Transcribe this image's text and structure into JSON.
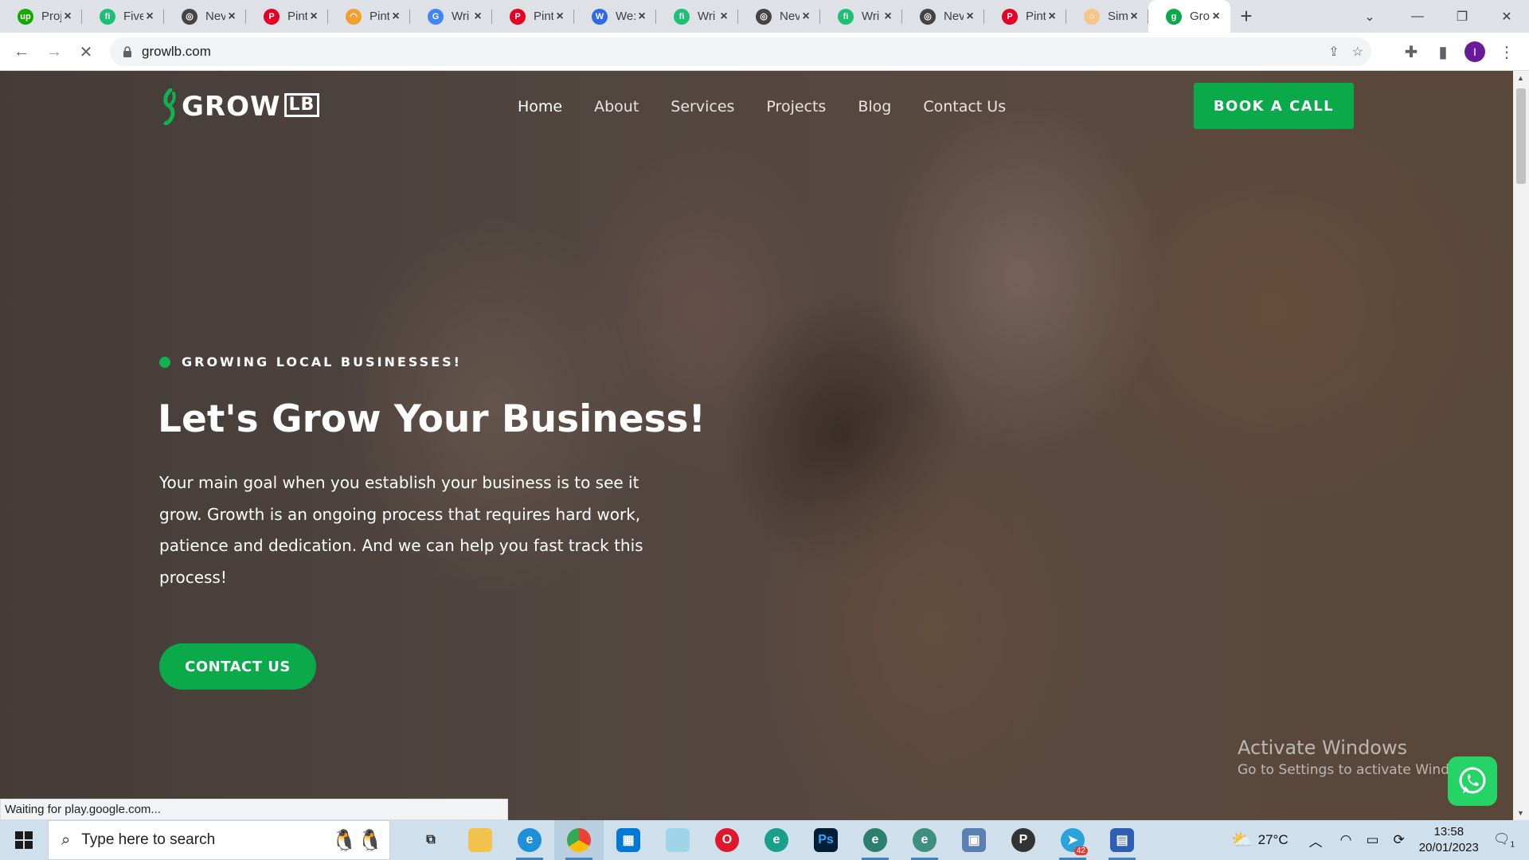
{
  "browser": {
    "tabs": [
      {
        "title": "Proj",
        "icon": "upwork-icon",
        "color": "#14a800",
        "glyph": "up"
      },
      {
        "title": "Five",
        "icon": "fiverr-icon",
        "color": "#1dbf73",
        "glyph": "fi"
      },
      {
        "title": "Nev",
        "icon": "chatgpt-icon",
        "color": "#444444",
        "glyph": "◎"
      },
      {
        "title": "Pint",
        "icon": "pinterest-icon",
        "color": "#e60023",
        "glyph": "P"
      },
      {
        "title": "Pint",
        "icon": "rainbow-icon",
        "color": "#f0a030",
        "glyph": "◠"
      },
      {
        "title": "Wri",
        "icon": "google-icon",
        "color": "#4285f4",
        "glyph": "G"
      },
      {
        "title": "Pint",
        "icon": "pinterest-icon",
        "color": "#e60023",
        "glyph": "P"
      },
      {
        "title": "We:",
        "icon": "wix-icon",
        "color": "#2e6ae6",
        "glyph": "W"
      },
      {
        "title": "Wri",
        "icon": "fiverr-icon",
        "color": "#1dbf73",
        "glyph": "fi"
      },
      {
        "title": "Nev",
        "icon": "chatgpt-icon",
        "color": "#444444",
        "glyph": "◎"
      },
      {
        "title": "Wri",
        "icon": "fiverr-icon",
        "color": "#1dbf73",
        "glyph": "fi"
      },
      {
        "title": "Nev",
        "icon": "chatgpt-icon",
        "color": "#444444",
        "glyph": "◎"
      },
      {
        "title": "Pint",
        "icon": "pinterest-icon",
        "color": "#e60023",
        "glyph": "P"
      },
      {
        "title": "Sim",
        "icon": "loading-icon",
        "color": "#f3c68a",
        "glyph": "○"
      },
      {
        "title": "Gro",
        "icon": "growlb-icon",
        "color": "#0aaa4b",
        "glyph": "g",
        "active": true
      }
    ],
    "url": "growlb.com",
    "status_text": "Waiting for play.google.com..."
  },
  "site": {
    "logo_text": "GROW",
    "logo_badge": "LB",
    "nav": [
      "Home",
      "About",
      "Services",
      "Projects",
      "Blog",
      "Contact Us"
    ],
    "book_button": "BOOK A CALL",
    "tagline": "GROWING LOCAL BUSINESSES!",
    "title": "Let's Grow Your Business!",
    "body": "Your main goal when you establish your business is to see it grow. Growth is an ongoing process that requires hard work, patience and dedication. And we can help you fast track this process!",
    "contact_button": "CONTACT US",
    "accent": "#0aaa4b"
  },
  "watermark": {
    "line1": "Activate Windows",
    "line2": "Go to Settings to activate Windows."
  },
  "taskbar": {
    "search_placeholder": "Type here to search",
    "weather": "27°C",
    "time": "13:58",
    "date": "20/01/2023",
    "notifications": "1",
    "telegram_badge": "42"
  }
}
